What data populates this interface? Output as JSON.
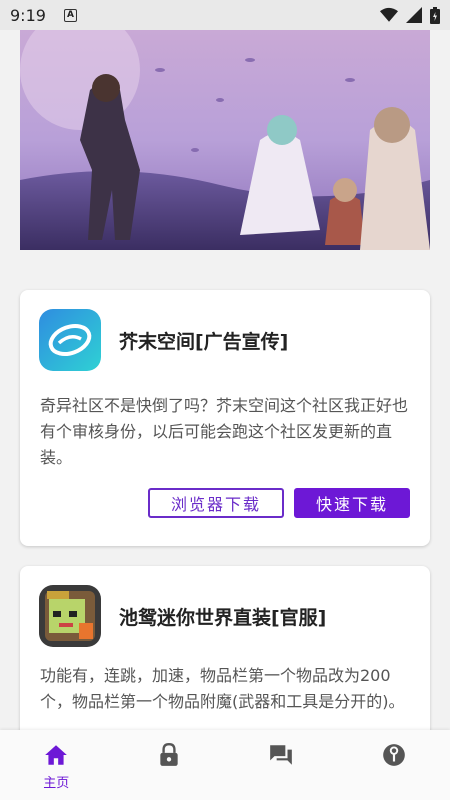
{
  "status_bar": {
    "time": "9:19",
    "notification_badge": "A"
  },
  "colors": {
    "accent": "#6d18d6",
    "accent_outline": "#6a2cc9"
  },
  "banner": {
    "image": "anime-artwork-banner"
  },
  "cards": [
    {
      "icon": "mustard-space-app-icon",
      "title": "芥末空间[广告宣传]",
      "description": "奇异社区不是快倒了吗？芥末空间这个社区我正好也有个审核身份，以后可能会跑这个社区发更新的直装。",
      "buttons": {
        "browser_download": "浏览器下载",
        "fast_download": "快速下载"
      }
    },
    {
      "icon": "mini-world-app-icon",
      "title": "池鸳迷你世界直装[官服]",
      "description": "功能有，连跳，加速，物品栏第一个物品改为200个，物品栏第一个物品附魔(武器和工具是分开的)。"
    }
  ],
  "bottom_nav": {
    "items": [
      {
        "icon": "home-icon",
        "label": "主页",
        "active": true
      },
      {
        "icon": "lock-icon",
        "label": "",
        "active": false
      },
      {
        "icon": "chat-icon",
        "label": "",
        "active": false
      },
      {
        "icon": "info-icon",
        "label": "",
        "active": false
      }
    ]
  }
}
